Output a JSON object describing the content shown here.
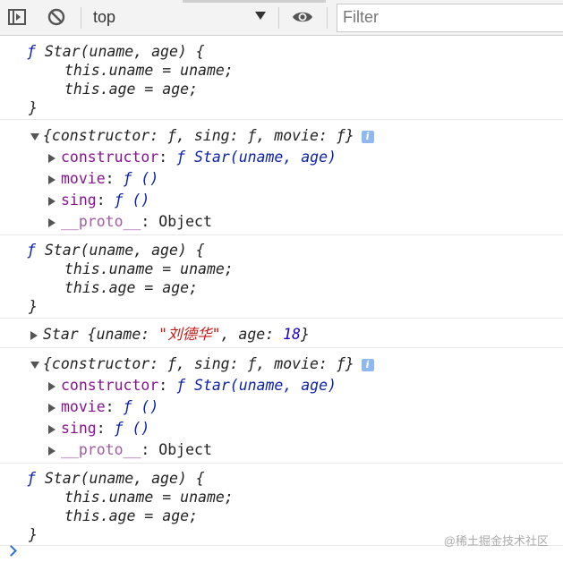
{
  "toolbar": {
    "context": "top",
    "filter_placeholder": "Filter"
  },
  "console": {
    "func_block": {
      "l1a": "ƒ ",
      "l1b": "Star(uname, age) {",
      "l2": "this.uname = uname;",
      "l3": "this.age = age;",
      "l4": "}"
    },
    "proto_summary": "{constructor: ƒ, sing: ƒ, movie: ƒ}",
    "proto_props": {
      "constructor_key": "constructor",
      "constructor_val": "ƒ Star(uname, age)",
      "movie_key": "movie",
      "movie_val": "ƒ ()",
      "sing_key": "sing",
      "sing_val": "ƒ ()",
      "proto_key": "__proto__",
      "proto_val": "Object"
    },
    "instance": {
      "name": "Star ",
      "open": "{uname: ",
      "uname": "\"刘德华\"",
      "mid": ", age: ",
      "age": "18",
      "close": "}"
    }
  },
  "watermark": "@稀土掘金技术社区",
  "colors": {
    "key": "#881391",
    "string": "#c41a16",
    "number": "#1c00cf"
  }
}
